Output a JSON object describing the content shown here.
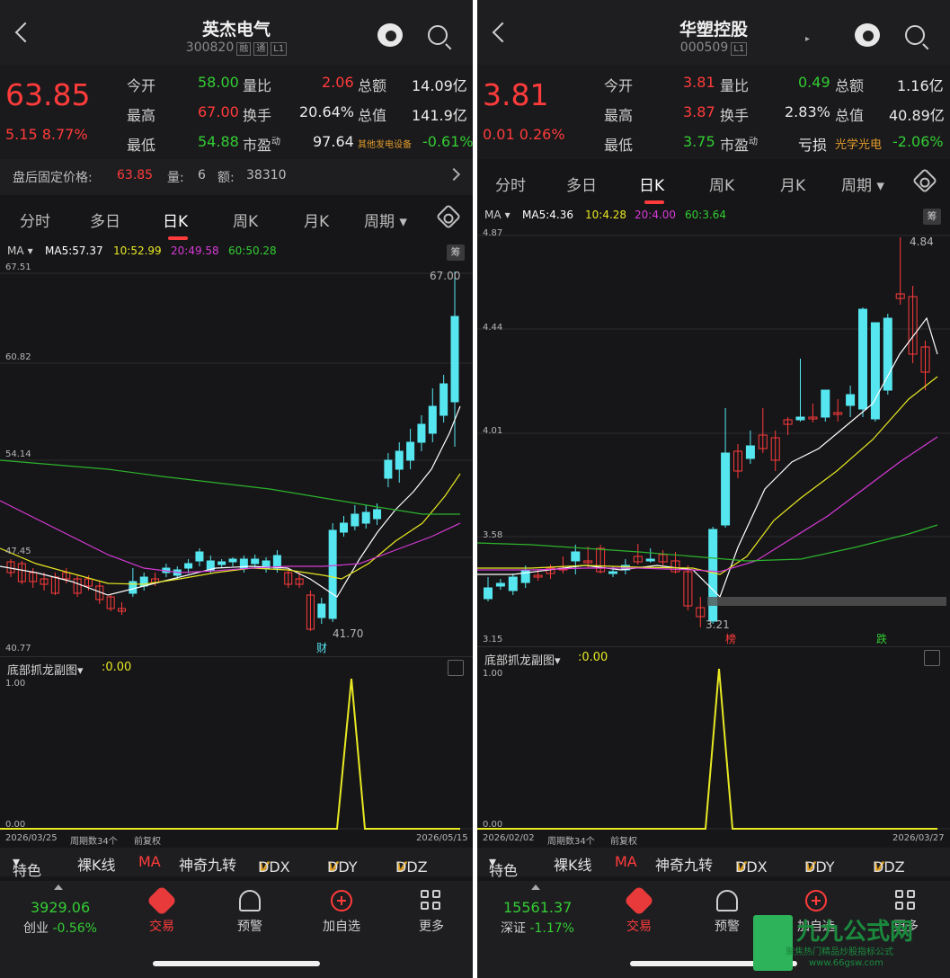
{
  "left": {
    "name": "英杰电气",
    "code": "300820",
    "tags": [
      "融",
      "通",
      "L1"
    ],
    "price": "63.85",
    "change": "5.15",
    "change_pct": "8.77%",
    "quote": {
      "open_label": "今开",
      "open": "58.00",
      "high_label": "最高",
      "high": "67.00",
      "low_label": "最低",
      "low": "54.88",
      "vr_label": "量比",
      "vr": "2.06",
      "turnover_label": "换手",
      "turnover": "20.64%",
      "pe_label": "市盈",
      "pe_sup": "动",
      "pe": "97.64",
      "amount_label": "总额",
      "amount": "14.09亿",
      "mktcap_label": "总值",
      "mktcap": "141.9亿",
      "sector": "其他发电设备",
      "sector_pct": "-0.61%"
    },
    "after_hours": {
      "label": "盘后固定价格:",
      "price": "63.85",
      "vol_label": "量:",
      "vol": "6",
      "amt_label": "额:",
      "amt": "38310"
    },
    "ma": {
      "label": "MA",
      "ma5": "MA5:57.37",
      "ma10": "10:52.99",
      "ma20": "20:49.58",
      "ma60": "60:50.28"
    },
    "y_ticks": [
      "67.51",
      "60.82",
      "54.14",
      "47.45",
      "40.77"
    ],
    "max_label": "67.00",
    "min_label": "41.70",
    "badge": "财",
    "sub_title": "底部抓龙副图",
    "sub_value": ":0.00",
    "sub_ticks": [
      "1.00",
      "0.00"
    ],
    "date_start": "2026/03/25",
    "period": "周期数34个",
    "adjust": "前复权",
    "date_end": "2026/05/15",
    "index_value": "3929.06",
    "index_name": "创业",
    "index_pct": "-0.56%"
  },
  "right": {
    "name": "华塑控股",
    "code": "000509",
    "tags": [
      "L1"
    ],
    "price": "3.81",
    "change": "0.01",
    "change_pct": "0.26%",
    "quote": {
      "open_label": "今开",
      "open": "3.81",
      "high_label": "最高",
      "high": "3.87",
      "low_label": "最低",
      "low": "3.75",
      "vr_label": "量比",
      "vr": "0.49",
      "turnover_label": "换手",
      "turnover": "2.83%",
      "pe_label": "市盈",
      "pe_sup": "动",
      "pe": "亏损",
      "amount_label": "总额",
      "amount": "1.16亿",
      "mktcap_label": "总值",
      "mktcap": "40.89亿",
      "sector": "光学光电",
      "sector_pct": "-2.06%"
    },
    "ma": {
      "label": "MA",
      "ma5": "MA5:4.36",
      "ma10": "10:4.28",
      "ma20": "20:4.00",
      "ma60": "60:3.64"
    },
    "y_ticks": [
      "4.87",
      "4.44",
      "4.01",
      "3.58",
      "3.15"
    ],
    "max_label": "4.84",
    "min_label": "3.21",
    "badge_red": "榜",
    "badge_green": "跌",
    "sub_title": "底部抓龙副图",
    "sub_value": ":0.00",
    "sub_ticks": [
      "1.00",
      "0.00"
    ],
    "date_start": "2026/02/02",
    "period": "周期数34个",
    "adjust": "前复权",
    "date_end": "2026/03/27",
    "index_value": "15561.37",
    "index_name": "深证",
    "index_pct": "-1.17%"
  },
  "tabs": [
    "分时",
    "多日",
    "日K",
    "周K",
    "月K",
    "周期"
  ],
  "indicators": [
    "特色",
    "裸K线",
    "MA",
    "神奇九转",
    "DDX",
    "DDY",
    "DDZ"
  ],
  "indicator_v": "V",
  "bottom_nav": [
    "交易",
    "预警",
    "加自选",
    "更多"
  ],
  "chou_label": "筹",
  "watermark": {
    "title": "九九公式网",
    "subtitle": "聚焦热门精品炒股指标公式",
    "url": "www.66gsw.com"
  },
  "colors": {
    "up": "#ff3b3b",
    "down": "#33cc33",
    "bear_candle": "#55e6f0",
    "ma5": "#ffffff",
    "ma10": "#e8e823",
    "ma20": "#d63ad6",
    "ma60": "#2db32d"
  }
}
